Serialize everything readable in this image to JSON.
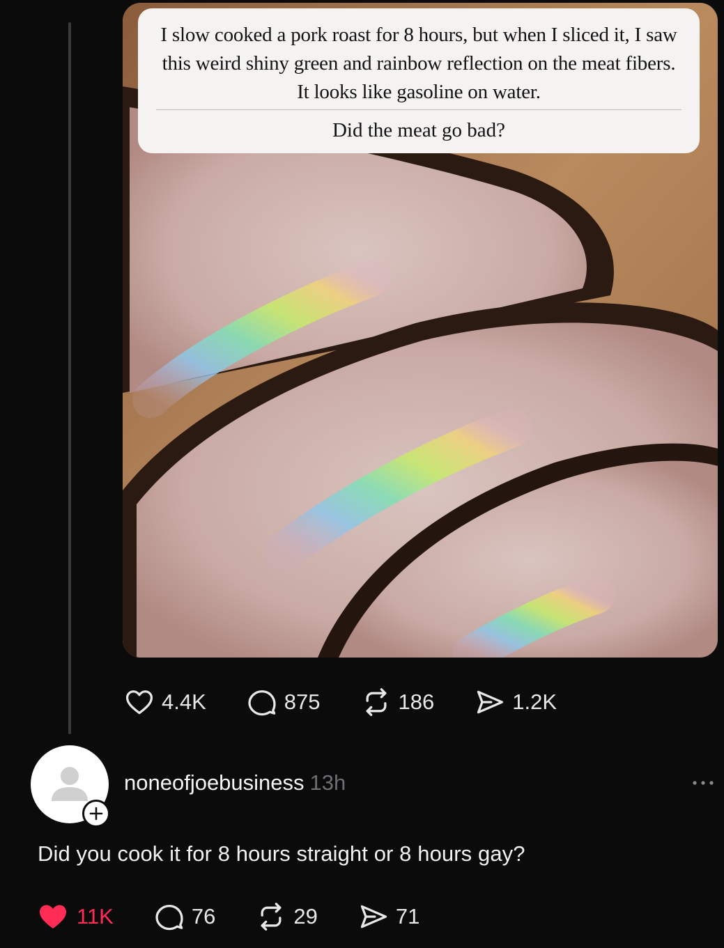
{
  "post": {
    "caption": {
      "text": "I slow cooked a pork roast for 8 hours, but when I sliced it, I saw this weird shiny green and rainbow reflection on the meat fibers. It looks like gasoline on water.",
      "question": "Did the meat go bad?"
    },
    "image": {
      "subject": "sliced pork roast with iridescent rainbow sheen"
    },
    "stats": {
      "likes": "4.4K",
      "comments": "875",
      "reposts": "186",
      "shares": "1.2K"
    }
  },
  "reply": {
    "username": "noneofjoebusiness",
    "time": "13h",
    "text": "Did you cook it for 8 hours straight or 8 hours gay?",
    "stats": {
      "likes": "11K",
      "comments": "76",
      "reposts": "29",
      "shares": "71"
    }
  },
  "icons": {
    "like": "heart-icon",
    "comment": "comment-bubble-icon",
    "repost": "repost-icon",
    "share": "send-icon",
    "avatar": "default-person-icon",
    "follow": "plus-icon",
    "more": "ellipsis-icon"
  },
  "colors": {
    "background": "#0b0b0c",
    "liked": "#ff2d55",
    "muted": "#6e6e73",
    "caption_bg": "#f4f3f1"
  }
}
